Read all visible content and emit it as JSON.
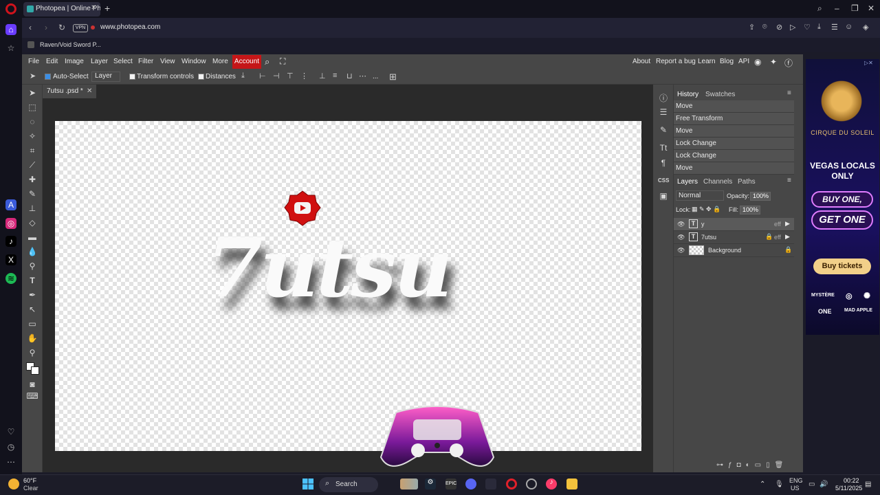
{
  "browser": {
    "tab_title": "Photopea | Online Photo E",
    "url": "www.photopea.com",
    "vpn_label": "VPN",
    "bookmark": "Raven/Void Sword P..."
  },
  "menu": {
    "items": [
      "File",
      "Edit",
      "Image",
      "Layer",
      "Select",
      "Filter",
      "View",
      "Window",
      "More"
    ],
    "account": "Account",
    "right_links": [
      "About",
      "Report a bug",
      "Learn",
      "Blog",
      "API"
    ]
  },
  "options": {
    "auto_select": "Auto-Select",
    "layer_mode": "Layer",
    "transform_controls": "Transform controls",
    "distances": "Distances",
    "more": "..."
  },
  "document": {
    "tab": "7utsu .psd *",
    "art_text": "7utsu"
  },
  "history": {
    "tabs": [
      "History",
      "Swatches"
    ],
    "items": [
      "Move",
      "Free Transform",
      "Move",
      "Lock Change",
      "Lock Change",
      "Move"
    ]
  },
  "layers": {
    "tabs": [
      "Layers",
      "Channels",
      "Paths"
    ],
    "blend_mode": "Normal",
    "opacity_label": "Opacity:",
    "opacity_value": "100%",
    "lock_label": "Lock:",
    "fill_label": "Fill:",
    "fill_value": "100%",
    "items": [
      {
        "name": "y",
        "type": "T",
        "fx": "eff"
      },
      {
        "name": "7utsu",
        "type": "T",
        "fx": "eff"
      },
      {
        "name": "Background",
        "type": "img",
        "fx": ""
      }
    ]
  },
  "panel_strip": {
    "css": "CSS"
  },
  "ad": {
    "brand": "CIRQUE DU SOLEIL",
    "headline": "VEGAS LOCALS ONLY",
    "pill1": "BUY ONE,",
    "pill2": "GET ONE",
    "button": "Buy tickets",
    "shows": [
      "MYSTÈRE",
      "ONE",
      "MAD APPLE"
    ]
  },
  "taskbar": {
    "temp": "60°F",
    "condition": "Clear",
    "search": "Search",
    "lang1": "ENG",
    "lang2": "US",
    "time": "00:22",
    "date": "5/11/2025"
  }
}
